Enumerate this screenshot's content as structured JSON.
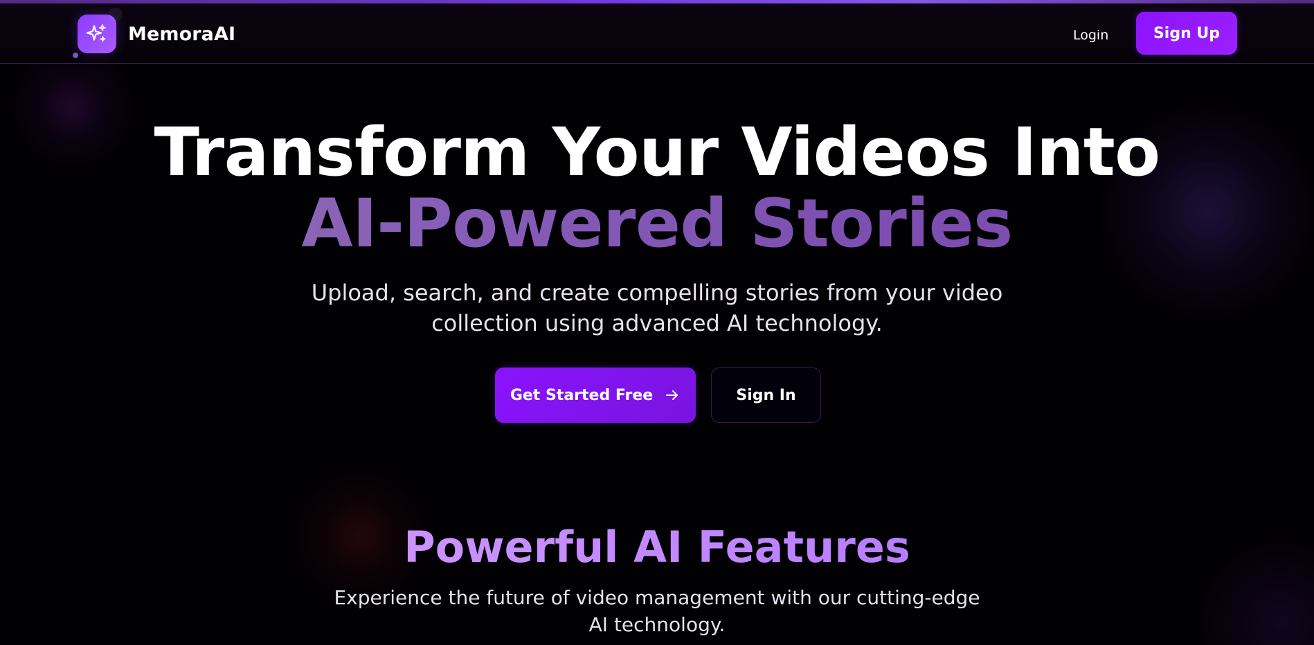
{
  "colors": {
    "accent": "#8D12FF",
    "accent_secondary": "#A85CFF",
    "hero_gradient_start": "#9272AD",
    "hero_gradient_end": "#7B4AB2",
    "features_gradient_start": "#D9A4FF",
    "features_gradient_end": "#A969FF",
    "background": "#010003"
  },
  "header": {
    "brand": "MemoraAI",
    "login_label": "Login",
    "signup_label": "Sign Up",
    "logo_icon": "sparkles-icon"
  },
  "hero": {
    "title_line1": "Transform Your Videos Into",
    "title_line2": "AI-Powered Stories",
    "subtitle": "Upload, search, and create compelling stories from your video collection using advanced AI technology.",
    "primary_cta_label": "Get Started Free",
    "primary_cta_icon": "arrow-right-icon",
    "secondary_cta_label": "Sign In"
  },
  "features": {
    "title": "Powerful AI Features",
    "subtitle": "Experience the future of video management with our cutting-edge AI technology."
  }
}
